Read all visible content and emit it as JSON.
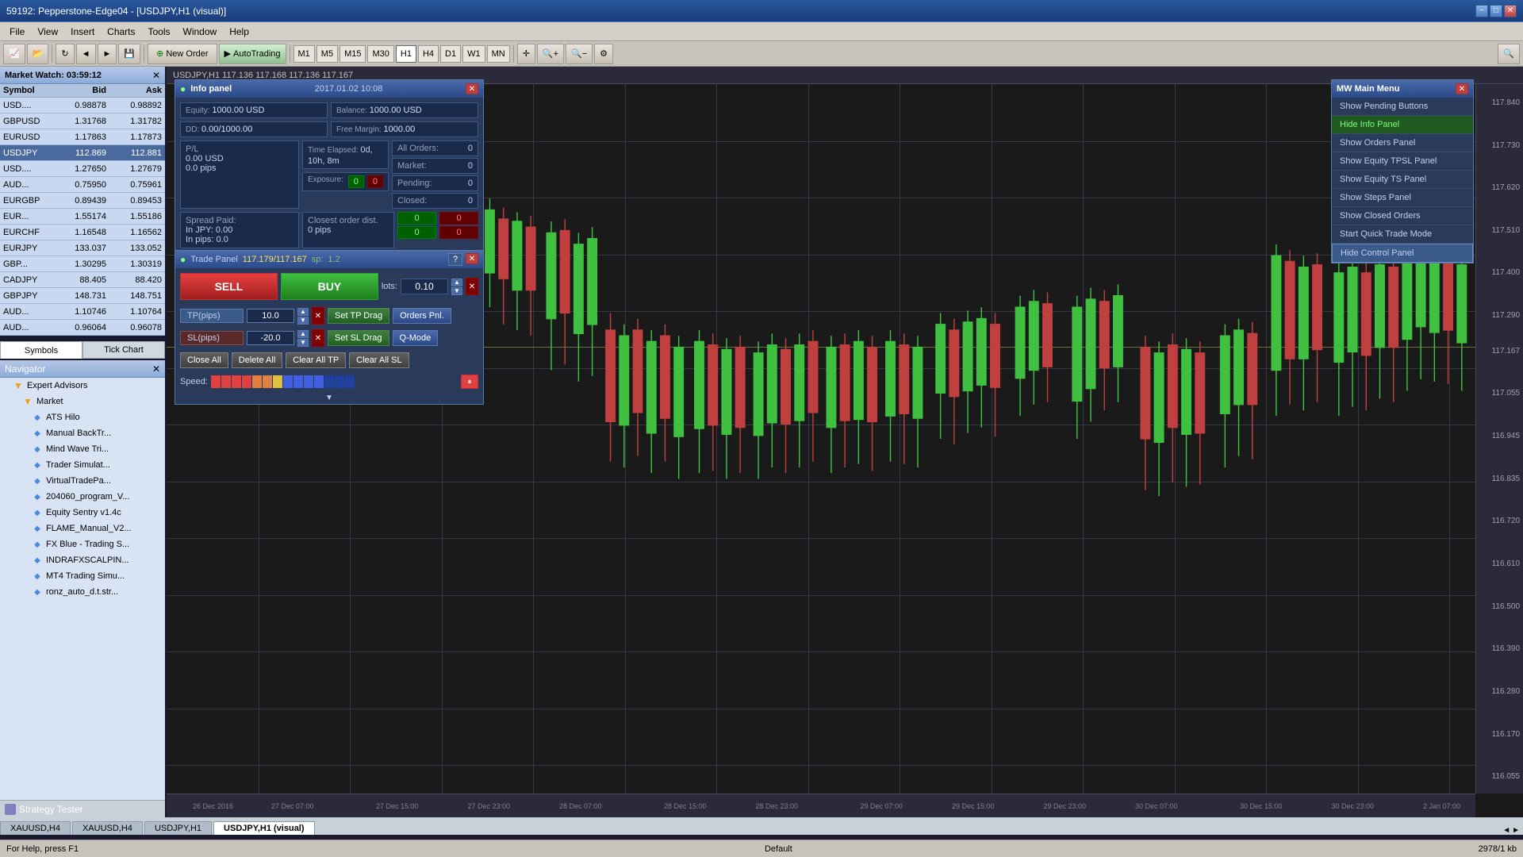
{
  "titlebar": {
    "title": "59192: Pepperstone-Edge04 - [USDJPY,H1 (visual)]",
    "minimize": "−",
    "maximize": "□",
    "close": "✕"
  },
  "menubar": {
    "items": [
      "File",
      "View",
      "Insert",
      "Charts",
      "Tools",
      "Window",
      "Help"
    ]
  },
  "toolbar": {
    "new_order": "New Order",
    "auto_trading": "AutoTrading",
    "timeframes": [
      "M1",
      "M5",
      "M15",
      "M30",
      "H1",
      "H4",
      "D1",
      "W1",
      "MN"
    ]
  },
  "market_watch": {
    "title": "Market Watch: 03:59:12",
    "columns": [
      "Symbol",
      "Bid",
      "Ask"
    ],
    "rows": [
      {
        "symbol": "USD....",
        "bid": "0.98878",
        "ask": "0.98892",
        "selected": false
      },
      {
        "symbol": "GBPUSD",
        "bid": "1.31768",
        "ask": "1.31782",
        "selected": false
      },
      {
        "symbol": "EURUSD",
        "bid": "1.17863",
        "ask": "1.17873",
        "selected": false
      },
      {
        "symbol": "USDJPY",
        "bid": "112.869",
        "ask": "112.881",
        "selected": true
      },
      {
        "symbol": "USD....",
        "bid": "1.27650",
        "ask": "1.27679",
        "selected": false
      },
      {
        "symbol": "AUD...",
        "bid": "0.75950",
        "ask": "0.75961",
        "selected": false
      },
      {
        "symbol": "EURGBP",
        "bid": "0.89439",
        "ask": "0.89453",
        "selected": false
      },
      {
        "symbol": "EUR...",
        "bid": "1.55174",
        "ask": "1.55186",
        "selected": false
      },
      {
        "symbol": "EURCHF",
        "bid": "1.16548",
        "ask": "1.16562",
        "selected": false
      },
      {
        "symbol": "EURJPY",
        "bid": "133.037",
        "ask": "133.052",
        "selected": false
      },
      {
        "symbol": "GBP...",
        "bid": "1.30295",
        "ask": "1.30319",
        "selected": false
      },
      {
        "symbol": "CADJPY",
        "bid": "88.405",
        "ask": "88.420",
        "selected": false
      },
      {
        "symbol": "GBPJPY",
        "bid": "148.731",
        "ask": "148.751",
        "selected": false
      },
      {
        "symbol": "AUD...",
        "bid": "1.10746",
        "ask": "1.10764",
        "selected": false
      },
      {
        "symbol": "AUD...",
        "bid": "0.96064",
        "ask": "0.96078",
        "selected": false
      }
    ],
    "tabs": [
      "Symbols",
      "Tick Chart"
    ]
  },
  "navigator": {
    "title": "Navigator",
    "items": [
      {
        "level": 1,
        "type": "folder",
        "label": "Expert Advisors",
        "expanded": true
      },
      {
        "level": 2,
        "type": "folder",
        "label": "Market",
        "expanded": true
      },
      {
        "level": 3,
        "type": "ea",
        "label": "ATS Hilo"
      },
      {
        "level": 3,
        "type": "ea",
        "label": "Manual BackTr..."
      },
      {
        "level": 3,
        "type": "ea",
        "label": "Mind Wave Tri..."
      },
      {
        "level": 3,
        "type": "ea",
        "label": "Trader Simulat..."
      },
      {
        "level": 3,
        "type": "ea",
        "label": "VirtualTradePa..."
      },
      {
        "level": 3,
        "type": "ea",
        "label": "204060_program_V..."
      },
      {
        "level": 3,
        "type": "ea",
        "label": "Equity Sentry v1.4c"
      },
      {
        "level": 3,
        "type": "ea",
        "label": "FLAME_Manual_V2..."
      },
      {
        "level": 3,
        "type": "ea",
        "label": "FX Blue - Trading S..."
      },
      {
        "level": 3,
        "type": "ea",
        "label": "INDRAFXSCALPIN..."
      },
      {
        "level": 3,
        "type": "ea",
        "label": "MT4 Trading Simu..."
      },
      {
        "level": 3,
        "type": "ea",
        "label": "ronz_auto_d.t.str..."
      }
    ]
  },
  "bottom_tabs": [
    "XAUUSD,H4",
    "XAUUSD,H4",
    "USDJPY,H1",
    "USDJPY,H1 (visual)"
  ],
  "strategy_tester": {
    "label": "Strategy Tester"
  },
  "statusbar": {
    "left": "For Help, press F1",
    "center": "Default",
    "right": "2978/1 kb"
  },
  "chart": {
    "title": "USDJPY,H1  117.136 117.168 117.136 117.167",
    "price_levels": [
      {
        "price": "117.840",
        "y_pct": 2
      },
      {
        "price": "117.730",
        "y_pct": 8
      },
      {
        "price": "117.620",
        "y_pct": 14
      },
      {
        "price": "117.510",
        "y_pct": 20
      },
      {
        "price": "117.400",
        "y_pct": 26
      },
      {
        "price": "117.290",
        "y_pct": 32
      },
      {
        "price": "117.167",
        "y_pct": 37
      },
      {
        "price": "117.055",
        "y_pct": 43
      },
      {
        "price": "116.945",
        "y_pct": 49
      },
      {
        "price": "116.835",
        "y_pct": 55
      },
      {
        "price": "116.720",
        "y_pct": 61
      },
      {
        "price": "116.610",
        "y_pct": 67
      },
      {
        "price": "116.500",
        "y_pct": 73
      },
      {
        "price": "116.390",
        "y_pct": 79
      },
      {
        "price": "116.280",
        "y_pct": 85
      },
      {
        "price": "116.170",
        "y_pct": 91
      },
      {
        "price": "116.055",
        "y_pct": 97
      }
    ],
    "time_labels": [
      {
        "label": "26 Dec 2016",
        "x_pct": 2
      },
      {
        "label": "27 Dec 07:00",
        "x_pct": 8
      },
      {
        "label": "27 Dec 15:00",
        "x_pct": 14
      },
      {
        "label": "27 Dec 23:00",
        "x_pct": 20
      },
      {
        "label": "28 Dec 07:00",
        "x_pct": 26
      },
      {
        "label": "28 Dec 15:00",
        "x_pct": 32
      },
      {
        "label": "28 Dec 23:00",
        "x_pct": 38
      },
      {
        "label": "29 Dec 07:00",
        "x_pct": 44
      },
      {
        "label": "29 Dec 15:00",
        "x_pct": 50
      },
      {
        "label": "29 Dec 23:00",
        "x_pct": 56
      },
      {
        "label": "30 Dec 07:00",
        "x_pct": 62
      },
      {
        "label": "30 Dec 15:00",
        "x_pct": 68
      },
      {
        "label": "30 Dec 23:00",
        "x_pct": 74
      },
      {
        "label": "2 Jan 07:00",
        "x_pct": 88
      }
    ]
  },
  "info_panel": {
    "title": "Info panel",
    "date": "2017.01.02 10:08",
    "equity_label": "Equity:",
    "equity_value": "1000.00 USD",
    "balance_label": "Balance:",
    "balance_value": "1000.00 USD",
    "dd_label": "DD:",
    "dd_value": "0.00/1000.00",
    "free_margin_label": "Free Margin:",
    "free_margin_value": "1000.00",
    "pl_label": "P/L",
    "pl_usd": "0.00 USD",
    "pl_pips": "0.0 pips",
    "time_elapsed_label": "Time Elapsed:",
    "time_elapsed_value": "0d, 10h, 8m",
    "spread_label": "Spread Paid:",
    "in_jpy": "In JPY: 0.00",
    "in_pips": "In pips: 0.0",
    "exposure_label": "Exposure:",
    "exposure_value": "-",
    "closest_order_label": "Closest order dist.",
    "closest_order_value": "0 pips",
    "all_orders_label": "All Orders:",
    "all_orders_value": "0",
    "market_label": "Market:",
    "market_value": "0",
    "pending_label": "Pending:",
    "pending_value": "0",
    "closed_label": "Closed:",
    "closed_value": "0",
    "green_0": "0",
    "red_0": "0",
    "green_1": "0",
    "red_1": "0"
  },
  "trade_panel": {
    "title": "Trade Panel",
    "price": "117.179/117.167",
    "sp_label": "sp:",
    "sp_value": "1.2",
    "sell_label": "SELL",
    "buy_label": "BUY",
    "lots_label": "lots:",
    "lots_value": "0.10",
    "tp_label": "TP(pips)",
    "tp_value": "10.0",
    "sl_label": "SL(pips)",
    "sl_value": "-20.0",
    "set_tp_drag": "Set TP Drag",
    "orders_pnl": "Orders Pnl.",
    "set_sl_drag": "Set SL Drag",
    "q_mode": "Q-Mode",
    "close_all": "Close All",
    "delete_all": "Delete All",
    "clear_all_tp": "Clear All TP",
    "clear_all_sl": "Clear All SL",
    "speed_label": "Speed:"
  },
  "mw_main_menu": {
    "title": "MW Main Menu",
    "items": [
      {
        "label": "Show Pending Buttons",
        "style": "normal"
      },
      {
        "label": "Hide Info Panel",
        "style": "green"
      },
      {
        "label": "Show Orders Panel",
        "style": "normal"
      },
      {
        "label": "Show Equity TPSL Panel",
        "style": "normal"
      },
      {
        "label": "Show Equity TS Panel",
        "style": "normal"
      },
      {
        "label": "Show Steps Panel",
        "style": "normal"
      },
      {
        "label": "Show Closed Orders",
        "style": "normal"
      },
      {
        "label": "Start Quick Trade Mode",
        "style": "normal"
      },
      {
        "label": "Hide Control Panel",
        "style": "highlighted"
      }
    ]
  },
  "colors": {
    "candle_bull": "#40c040",
    "candle_bear": "#c04040",
    "bg_chart": "#1a1a1a",
    "panel_bg": "#2a3a5a",
    "highlight_green": "#205a20",
    "highlight_blue": "#3a5a8a"
  }
}
